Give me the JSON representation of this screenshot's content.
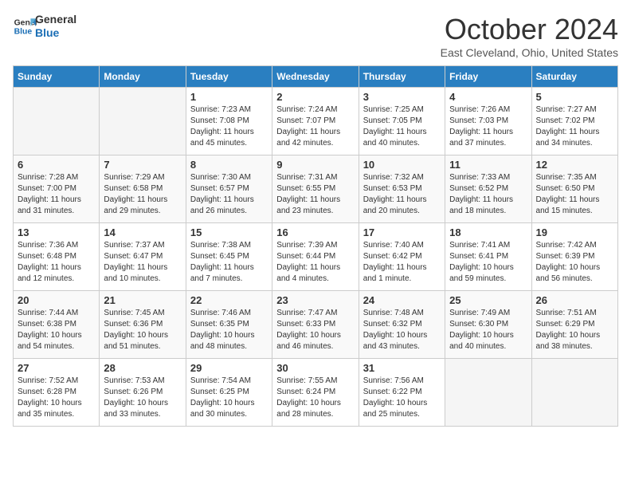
{
  "logo": {
    "line1": "General",
    "line2": "Blue"
  },
  "title": "October 2024",
  "location": "East Cleveland, Ohio, United States",
  "days_of_week": [
    "Sunday",
    "Monday",
    "Tuesday",
    "Wednesday",
    "Thursday",
    "Friday",
    "Saturday"
  ],
  "weeks": [
    [
      {
        "num": "",
        "info": "",
        "empty": true
      },
      {
        "num": "",
        "info": "",
        "empty": true
      },
      {
        "num": "1",
        "info": "Sunrise: 7:23 AM\nSunset: 7:08 PM\nDaylight: 11 hours\nand 45 minutes."
      },
      {
        "num": "2",
        "info": "Sunrise: 7:24 AM\nSunset: 7:07 PM\nDaylight: 11 hours\nand 42 minutes."
      },
      {
        "num": "3",
        "info": "Sunrise: 7:25 AM\nSunset: 7:05 PM\nDaylight: 11 hours\nand 40 minutes."
      },
      {
        "num": "4",
        "info": "Sunrise: 7:26 AM\nSunset: 7:03 PM\nDaylight: 11 hours\nand 37 minutes."
      },
      {
        "num": "5",
        "info": "Sunrise: 7:27 AM\nSunset: 7:02 PM\nDaylight: 11 hours\nand 34 minutes."
      }
    ],
    [
      {
        "num": "6",
        "info": "Sunrise: 7:28 AM\nSunset: 7:00 PM\nDaylight: 11 hours\nand 31 minutes."
      },
      {
        "num": "7",
        "info": "Sunrise: 7:29 AM\nSunset: 6:58 PM\nDaylight: 11 hours\nand 29 minutes."
      },
      {
        "num": "8",
        "info": "Sunrise: 7:30 AM\nSunset: 6:57 PM\nDaylight: 11 hours\nand 26 minutes."
      },
      {
        "num": "9",
        "info": "Sunrise: 7:31 AM\nSunset: 6:55 PM\nDaylight: 11 hours\nand 23 minutes."
      },
      {
        "num": "10",
        "info": "Sunrise: 7:32 AM\nSunset: 6:53 PM\nDaylight: 11 hours\nand 20 minutes."
      },
      {
        "num": "11",
        "info": "Sunrise: 7:33 AM\nSunset: 6:52 PM\nDaylight: 11 hours\nand 18 minutes."
      },
      {
        "num": "12",
        "info": "Sunrise: 7:35 AM\nSunset: 6:50 PM\nDaylight: 11 hours\nand 15 minutes."
      }
    ],
    [
      {
        "num": "13",
        "info": "Sunrise: 7:36 AM\nSunset: 6:48 PM\nDaylight: 11 hours\nand 12 minutes."
      },
      {
        "num": "14",
        "info": "Sunrise: 7:37 AM\nSunset: 6:47 PM\nDaylight: 11 hours\nand 10 minutes."
      },
      {
        "num": "15",
        "info": "Sunrise: 7:38 AM\nSunset: 6:45 PM\nDaylight: 11 hours\nand 7 minutes."
      },
      {
        "num": "16",
        "info": "Sunrise: 7:39 AM\nSunset: 6:44 PM\nDaylight: 11 hours\nand 4 minutes."
      },
      {
        "num": "17",
        "info": "Sunrise: 7:40 AM\nSunset: 6:42 PM\nDaylight: 11 hours\nand 1 minute."
      },
      {
        "num": "18",
        "info": "Sunrise: 7:41 AM\nSunset: 6:41 PM\nDaylight: 10 hours\nand 59 minutes."
      },
      {
        "num": "19",
        "info": "Sunrise: 7:42 AM\nSunset: 6:39 PM\nDaylight: 10 hours\nand 56 minutes."
      }
    ],
    [
      {
        "num": "20",
        "info": "Sunrise: 7:44 AM\nSunset: 6:38 PM\nDaylight: 10 hours\nand 54 minutes."
      },
      {
        "num": "21",
        "info": "Sunrise: 7:45 AM\nSunset: 6:36 PM\nDaylight: 10 hours\nand 51 minutes."
      },
      {
        "num": "22",
        "info": "Sunrise: 7:46 AM\nSunset: 6:35 PM\nDaylight: 10 hours\nand 48 minutes."
      },
      {
        "num": "23",
        "info": "Sunrise: 7:47 AM\nSunset: 6:33 PM\nDaylight: 10 hours\nand 46 minutes."
      },
      {
        "num": "24",
        "info": "Sunrise: 7:48 AM\nSunset: 6:32 PM\nDaylight: 10 hours\nand 43 minutes."
      },
      {
        "num": "25",
        "info": "Sunrise: 7:49 AM\nSunset: 6:30 PM\nDaylight: 10 hours\nand 40 minutes."
      },
      {
        "num": "26",
        "info": "Sunrise: 7:51 AM\nSunset: 6:29 PM\nDaylight: 10 hours\nand 38 minutes."
      }
    ],
    [
      {
        "num": "27",
        "info": "Sunrise: 7:52 AM\nSunset: 6:28 PM\nDaylight: 10 hours\nand 35 minutes."
      },
      {
        "num": "28",
        "info": "Sunrise: 7:53 AM\nSunset: 6:26 PM\nDaylight: 10 hours\nand 33 minutes."
      },
      {
        "num": "29",
        "info": "Sunrise: 7:54 AM\nSunset: 6:25 PM\nDaylight: 10 hours\nand 30 minutes."
      },
      {
        "num": "30",
        "info": "Sunrise: 7:55 AM\nSunset: 6:24 PM\nDaylight: 10 hours\nand 28 minutes."
      },
      {
        "num": "31",
        "info": "Sunrise: 7:56 AM\nSunset: 6:22 PM\nDaylight: 10 hours\nand 25 minutes."
      },
      {
        "num": "",
        "info": "",
        "empty": true
      },
      {
        "num": "",
        "info": "",
        "empty": true
      }
    ]
  ]
}
